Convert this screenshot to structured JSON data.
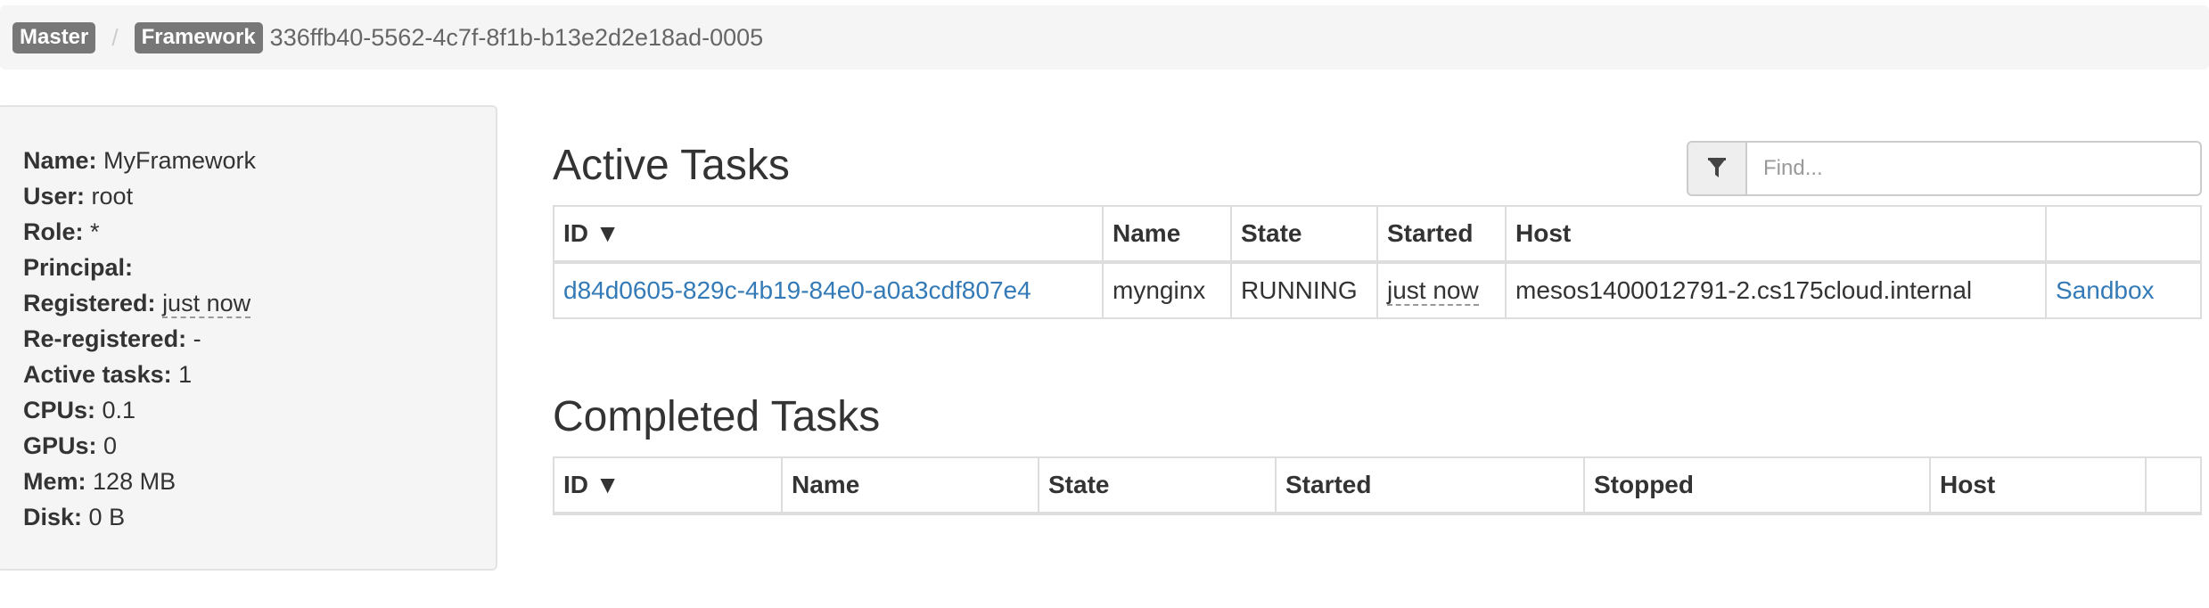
{
  "breadcrumb": {
    "master_label": "Master",
    "separator": "/",
    "framework_label": "Framework",
    "framework_id": "336ffb40-5562-4c7f-8f1b-b13e2d2e18ad-0005"
  },
  "framework_info": [
    {
      "key": "Name:",
      "value": "MyFramework",
      "dashed": false
    },
    {
      "key": "User:",
      "value": "root",
      "dashed": false
    },
    {
      "key": "Role:",
      "value": "*",
      "dashed": false
    },
    {
      "key": "Principal:",
      "value": "",
      "dashed": false
    },
    {
      "key": "Registered:",
      "value": "just now",
      "dashed": true
    },
    {
      "key": "Re-registered:",
      "value": "-",
      "dashed": false
    },
    {
      "key": "Active tasks:",
      "value": "1",
      "dashed": false
    },
    {
      "key": "CPUs:",
      "value": "0.1",
      "dashed": false
    },
    {
      "key": "GPUs:",
      "value": "0",
      "dashed": false
    },
    {
      "key": "Mem:",
      "value": "128 MB",
      "dashed": false
    },
    {
      "key": "Disk:",
      "value": "0 B",
      "dashed": false
    }
  ],
  "active_tasks": {
    "title": "Active Tasks",
    "find_placeholder": "Find...",
    "columns": [
      "ID ▼",
      "Name",
      "State",
      "Started",
      "Host",
      ""
    ],
    "rows": [
      {
        "id": "d84d0605-829c-4b19-84e0-a0a3cdf807e4",
        "name": "mynginx",
        "state": "RUNNING",
        "started": "just now",
        "host": "mesos1400012791-2.cs175cloud.internal",
        "action": "Sandbox"
      }
    ]
  },
  "completed_tasks": {
    "title": "Completed Tasks",
    "columns": [
      "ID ▼",
      "Name",
      "State",
      "Started",
      "Stopped",
      "Host",
      ""
    ]
  },
  "icons": {
    "filter": "filter-icon"
  },
  "colors": {
    "link": "#337ab7",
    "label_bg": "#777777",
    "panel_bg": "#f5f5f5"
  }
}
